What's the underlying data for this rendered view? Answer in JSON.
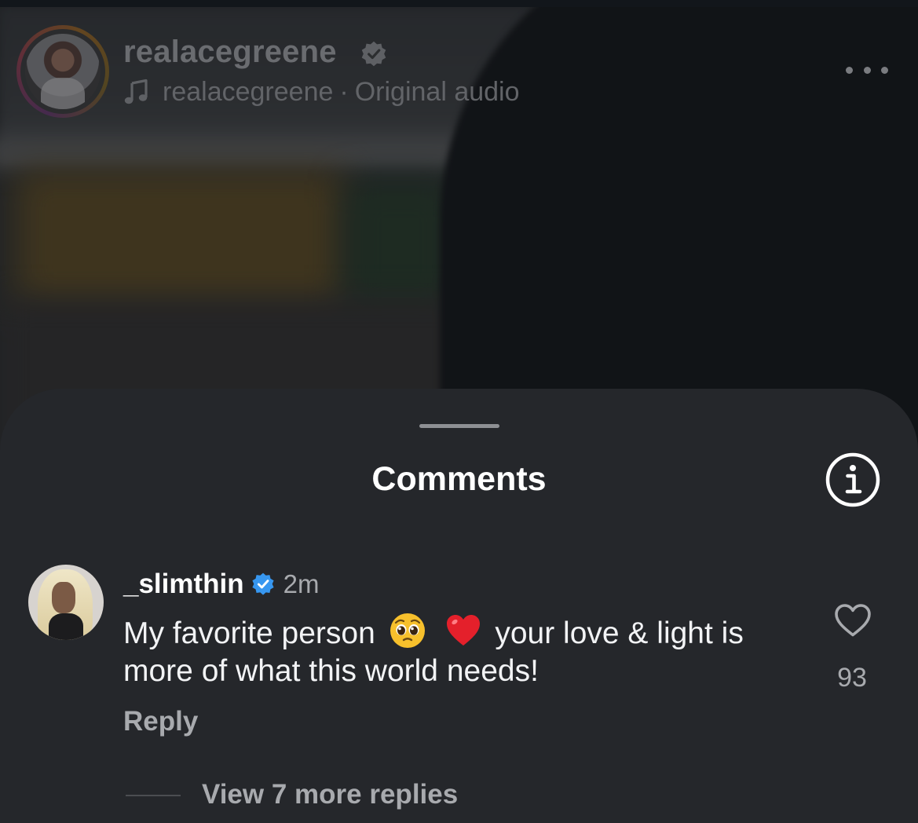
{
  "reel": {
    "author": {
      "username": "realacegreene",
      "verified_icon": "verified-badge-icon"
    },
    "audio": {
      "icon": "music-note-icon",
      "artist": "realacegreene",
      "separator": "·",
      "label": "Original audio"
    },
    "more_icon": "more-horizontal-icon"
  },
  "comments_sheet": {
    "title": "Comments",
    "info_icon": "info-icon",
    "comment": {
      "username": "_slimthin",
      "verified_icon": "verified-badge-icon",
      "time": "2m",
      "text_before": "My favorite person",
      "emoji_1": "pleading-face-emoji",
      "emoji_2": "red-heart-emoji",
      "text_after": "your love & light is more of what this world needs!",
      "like_icon": "heart-outline-icon",
      "like_count": "93",
      "reply_label": "Reply",
      "view_replies_label": "View 7 more replies"
    }
  },
  "colors": {
    "sheet_bg": "#25272b",
    "verified_blue": "#3797f0",
    "secondary_text": "#a8aaae",
    "primary_text": "#ffffff"
  }
}
